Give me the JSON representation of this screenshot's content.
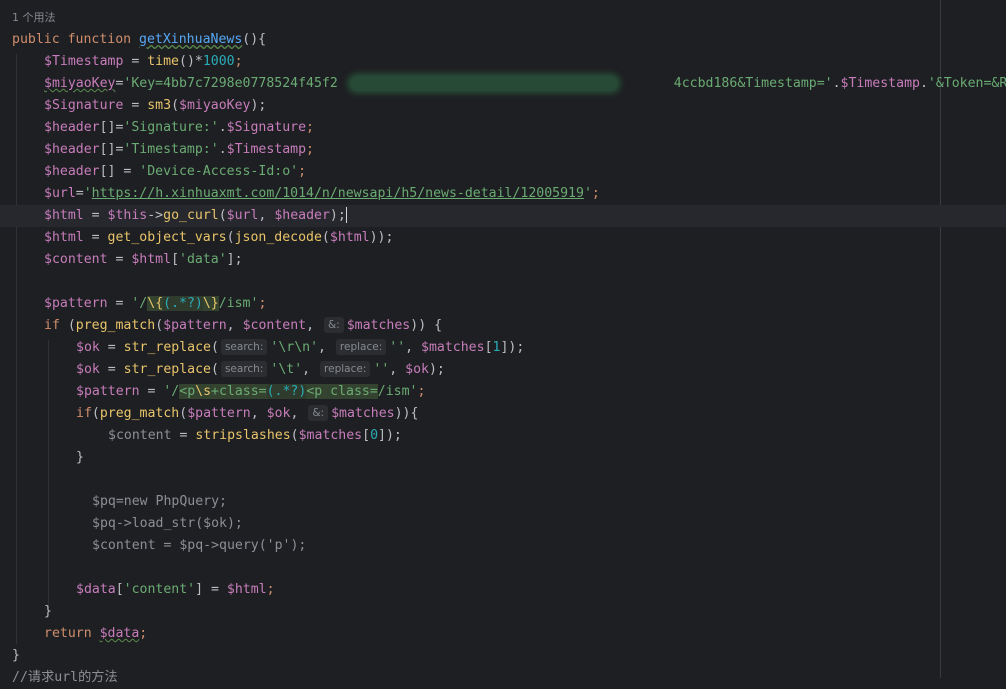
{
  "editor": {
    "usage_hint": "1 个用法",
    "hints": {
      "search": "search:",
      "replace": "replace:",
      "ref": "&:"
    },
    "code": {
      "l1_kw_public": "public ",
      "l1_kw_function": "function ",
      "l1_fn_name": "getXinhuaNews",
      "l1_tail": "(){",
      "l2_var": "$Timestamp",
      "l2_eq": " = ",
      "l2_fn": "time",
      "l2_mid": "()*",
      "l2_num": "1000",
      "l2_end": ";",
      "l3_var": "$miyaoKey",
      "l3_eq": "=",
      "l3_str1": "'Key=4bb7c7298e0778524f45f2",
      "l3_str2": "4ccbd186&Timestamp='",
      "l3_dot1": ".",
      "l3_var2": "$Timestamp",
      "l3_dot2": ".",
      "l3_str3": "'&Token=&Request=",
      "l4_var": "$Signature",
      "l4_eq": " = ",
      "l4_fn": "sm3",
      "l4_open": "(",
      "l4_arg": "$miyaoKey",
      "l4_end": ");",
      "l5_var": "$header",
      "l5_br": "[]=",
      "l5_str": "'Signature:'",
      "l5_dot": ".",
      "l5_var2": "$Signature",
      "l5_end": ";",
      "l6_var": "$header",
      "l6_br": "[]=",
      "l6_str": "'Timestamp:'",
      "l6_dot": ".",
      "l6_var2": "$Timestamp",
      "l6_end": ";",
      "l7_var": "$header",
      "l7_br": "[] = ",
      "l7_str": "'Device-Access-Id:o'",
      "l7_end": ";",
      "l8_var": "$url",
      "l8_eq": "=",
      "l8_q1": "'",
      "l8_url": "https://h.xinhuaxmt.com/1014/n/newsapi/h5/news-detail/12005919",
      "l8_q2": "'",
      "l8_end": ";",
      "l9_var": "$html",
      "l9_eq": " = ",
      "l9_this": "$this",
      "l9_arrow": "->",
      "l9_fn": "go_curl",
      "l9_open": "(",
      "l9_arg1": "$url",
      "l9_comma": ", ",
      "l9_arg2": "$header",
      "l9_end": ");",
      "l10_var": "$html",
      "l10_eq": " = ",
      "l10_fn": "get_object_vars",
      "l10_open": "(",
      "l10_fn2": "json_decode",
      "l10_open2": "(",
      "l10_arg": "$html",
      "l10_end": "));",
      "l11_var": "$content",
      "l11_eq": " = ",
      "l11_var2": "$html",
      "l11_open": "[",
      "l11_str": "'data'",
      "l11_end": "];",
      "l13_var": "$pattern",
      "l13_eq": " = ",
      "l13_q": "'/",
      "l13_rx1": "\\{",
      "l13_rx2": "(.*?)",
      "l13_rx3": "\\}",
      "l13_rest": "/ism'",
      "l13_end": ";",
      "l14_kw": "if",
      "l14_open": " (",
      "l14_fn": "preg_match",
      "l14_open2": "(",
      "l14_arg1": "$pattern",
      "l14_comma1": ", ",
      "l14_arg2": "$content",
      "l14_comma2": ", ",
      "l14_arg3": "$matches",
      "l14_end": ")) {",
      "l15_var": "$ok",
      "l15_eq": " = ",
      "l15_fn": "str_replace",
      "l15_open": "(",
      "l15_str1": "'\\r\\n'",
      "l15_comma1": ", ",
      "l15_str2": "''",
      "l15_comma2": ", ",
      "l15_arg": "$matches",
      "l15_idx_open": "[",
      "l15_idx": "1",
      "l15_end": "]);",
      "l16_var": "$ok",
      "l16_eq": " = ",
      "l16_fn": "str_replace",
      "l16_open": "(",
      "l16_str1": "'\\t'",
      "l16_comma1": ", ",
      "l16_str2": "''",
      "l16_comma2": ", ",
      "l16_arg": "$ok",
      "l16_end": ");",
      "l17_var": "$pattern",
      "l17_eq": " = ",
      "l17_q": "'/",
      "l17_rx1": "<p",
      "l17_rx2": "\\s",
      "l17_rx3": "+class=",
      "l17_rx4": "(.*?)",
      "l17_rx5": "<p class=",
      "l17_rest": "/ism'",
      "l17_end": ";",
      "l18_kw": "if",
      "l18_open": "(",
      "l18_fn": "preg_match",
      "l18_open2": "(",
      "l18_arg1": "$pattern",
      "l18_comma1": ", ",
      "l18_arg2": "$ok",
      "l18_comma2": ", ",
      "l18_arg3": "$matches",
      "l18_end": ")){",
      "l19_var": "$content",
      "l19_eq": " = ",
      "l19_fn": "stripslashes",
      "l19_open": "(",
      "l19_arg": "$matches",
      "l19_idx_open": "[",
      "l19_idx": "0",
      "l19_end": "]);",
      "l20": "}",
      "l22": "$pq=new PhpQuery;",
      "l23": "$pq->load_str($ok);",
      "l24": "$content = $pq->query('p');",
      "l26_var": "$data",
      "l26_open": "[",
      "l26_str": "'content'",
      "l26_mid": "] = ",
      "l26_var2": "$html",
      "l26_end": ";",
      "l27": "}",
      "l28_kw": "return ",
      "l28_var": "$data",
      "l28_end": ";",
      "l29": "}",
      "l30": "//请求url的方法"
    }
  }
}
